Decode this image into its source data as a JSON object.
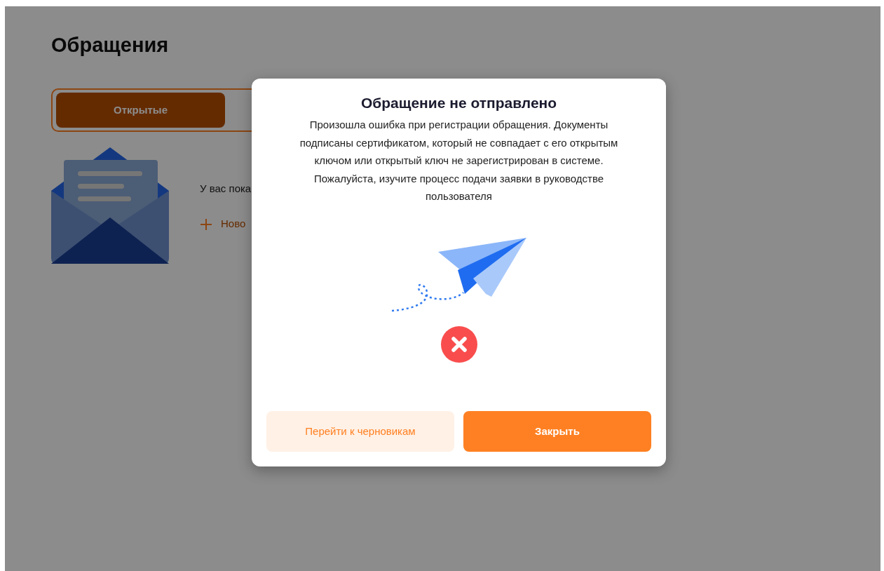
{
  "page": {
    "title": "Обращения",
    "tabs": [
      {
        "label": "Открытые",
        "selected": true
      }
    ],
    "empty_state": {
      "text": "У вас пока",
      "new_link": "Ново"
    }
  },
  "dialog": {
    "title": "Обращение не отправлено",
    "message": "Произошла ошибка при регистрации обращения. Документы подписаны сертификатом, который не совпадает с его открытым ключом или открытый ключ не зарегистрирован в системе. Пожалуйста, изучите процесс подачи заявки в руководстве пользователя",
    "buttons": [
      {
        "label": "Перейти к черновикам",
        "kind": "secondary"
      },
      {
        "label": "Закрыть",
        "kind": "primary"
      }
    ]
  }
}
